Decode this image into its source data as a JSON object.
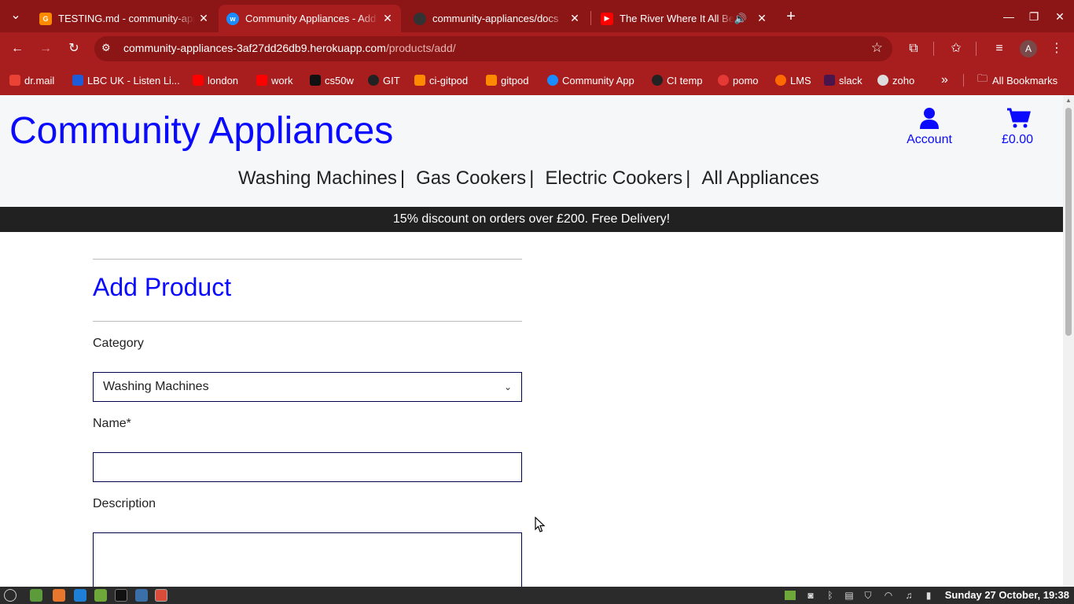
{
  "browser": {
    "tabs": [
      {
        "title": "TESTING.md - community-appliances",
        "favicon": "gitpod-icon",
        "active": false
      },
      {
        "title": "Community Appliances - Add Product",
        "favicon": "wca-icon",
        "active": true
      },
      {
        "title": "community-appliances/docs",
        "favicon": "github-icon",
        "active": false
      },
      {
        "title": "The River Where It All Began",
        "favicon": "youtube-icon",
        "active": false,
        "audio": true
      }
    ],
    "new_tab_label": "+",
    "url_host": "community-appliances-3af27dd26db9.herokuapp.com",
    "url_path": "/products/add/",
    "bookmarks": [
      {
        "label": "dr.mail",
        "icon": "gmail-icon",
        "color": "#ea4335"
      },
      {
        "label": "LBC UK - Listen Li...",
        "icon": "lbc-icon",
        "color": "#1e5bd8"
      },
      {
        "label": "london",
        "icon": "youtube-icon",
        "color": "#ff0000"
      },
      {
        "label": "work",
        "icon": "youtube-icon",
        "color": "#ff0000"
      },
      {
        "label": "cs50w",
        "icon": "x-icon",
        "color": "#111111"
      },
      {
        "label": "GIT",
        "icon": "github-icon",
        "color": "#222222"
      },
      {
        "label": "ci-gitpod",
        "icon": "gitpod-icon",
        "color": "#ff8a00"
      },
      {
        "label": "gitpod",
        "icon": "gitpod-icon",
        "color": "#ff8a00"
      },
      {
        "label": "Community App",
        "icon": "wca-icon",
        "color": "#1a8cff"
      },
      {
        "label": "CI temp",
        "icon": "github-icon",
        "color": "#222222"
      },
      {
        "label": "pomo",
        "icon": "tomato-icon",
        "color": "#e53935"
      },
      {
        "label": "LMS",
        "icon": "lms-icon",
        "color": "#ff6a00"
      },
      {
        "label": "slack",
        "icon": "slack-icon",
        "color": "#4a154b"
      },
      {
        "label": "zoho",
        "icon": "zoho-icon",
        "color": "#dddddd"
      }
    ],
    "bookmarks_overflow": "»",
    "all_bookmarks": "All Bookmarks",
    "profile_initial": "A"
  },
  "site": {
    "logo": "Community Appliances",
    "account_label": "Account",
    "cart_total": "£0.00",
    "nav": [
      "Washing Machines",
      "Gas Cookers",
      "Electric Cookers",
      "All Appliances"
    ],
    "nav_separator": "|",
    "banner": "15% discount on orders over £200. Free Delivery!",
    "accent_color": "#0a0aff"
  },
  "form": {
    "title": "Add Product",
    "category_label": "Category",
    "category_value": "Washing Machines",
    "name_label": "Name*",
    "name_value": "",
    "description_label": "Description",
    "description_value": ""
  },
  "taskbar": {
    "clock": "Sunday 27 October, 19:38"
  }
}
